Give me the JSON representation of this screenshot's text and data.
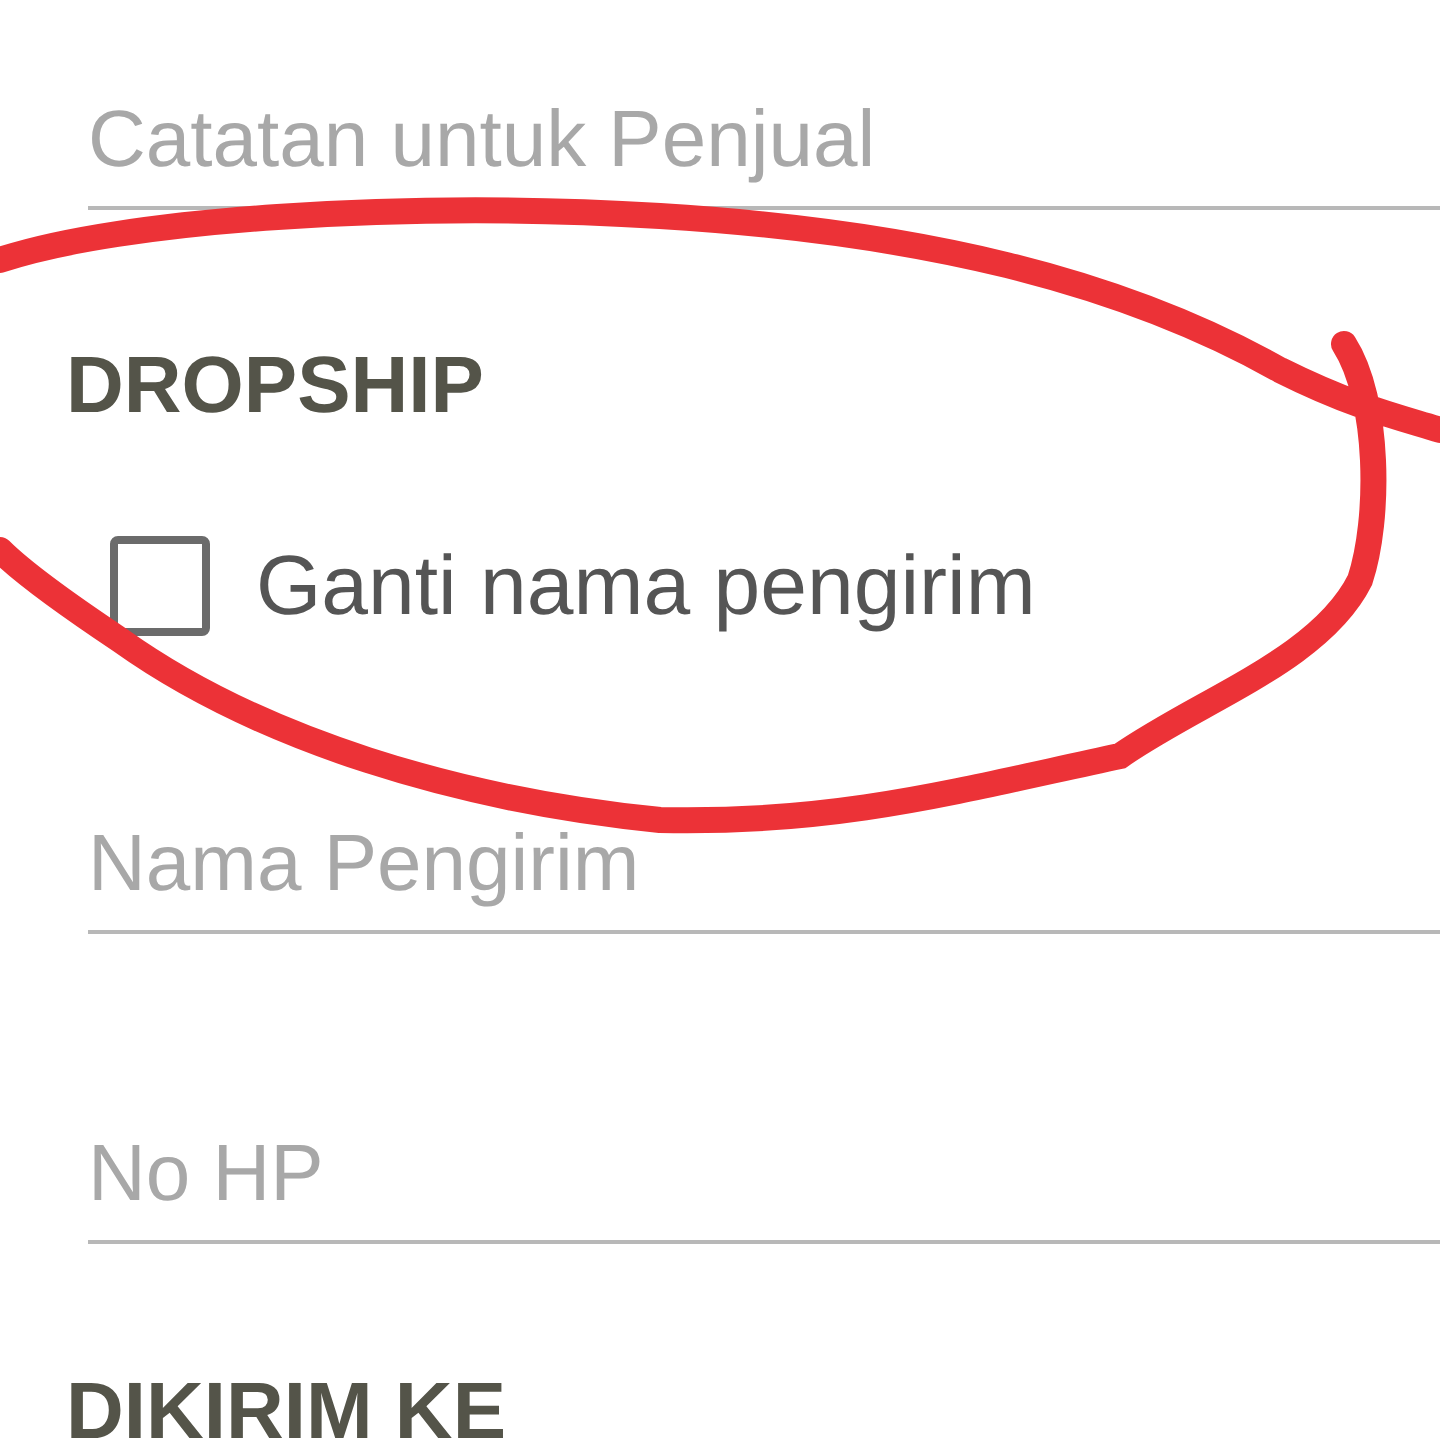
{
  "note_field": {
    "placeholder": "Catatan untuk Penjual"
  },
  "dropship": {
    "heading": "DROPSHIP",
    "checkbox": {
      "label": "Ganti nama pengirim",
      "checked": false
    },
    "fields": [
      {
        "placeholder": "Nama Pengirim"
      },
      {
        "placeholder": "No HP"
      }
    ]
  },
  "shipping": {
    "heading": "DIKIRIM KE"
  }
}
